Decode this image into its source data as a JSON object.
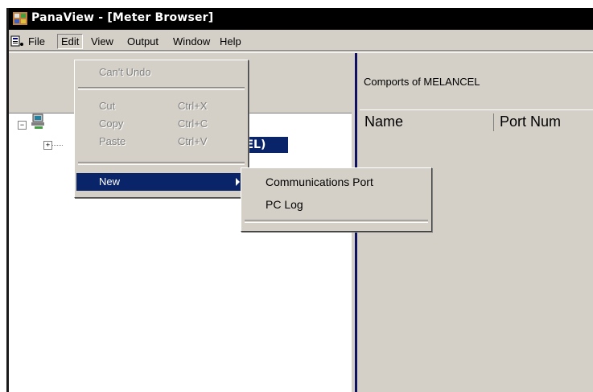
{
  "window": {
    "title": "PanaView - [Meter Browser]"
  },
  "menubar": {
    "items": [
      "File",
      "Edit",
      "View",
      "Output",
      "Window",
      "Help"
    ]
  },
  "edit_menu": {
    "undo": "Can't Undo",
    "cut": "Cut",
    "cut_accel": "Ctrl+X",
    "copy": "Copy",
    "copy_accel": "Ctrl+C",
    "paste": "Paste",
    "paste_accel": "Ctrl+V",
    "new": "New"
  },
  "new_submenu": {
    "items": [
      "Communications Port",
      "PC Log"
    ]
  },
  "tree": {
    "selected_fragment": "ICEL)"
  },
  "right_pane": {
    "title": "Comports of MELANCEL",
    "columns": [
      "Name",
      "Port Num"
    ]
  },
  "colors": {
    "highlight": "#0a246a",
    "face": "#d4d0c8"
  }
}
